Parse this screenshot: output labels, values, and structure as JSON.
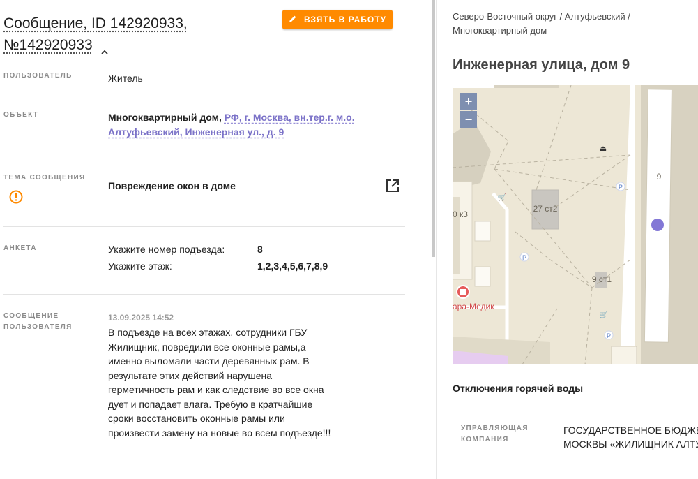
{
  "header": {
    "title_line1": "Сообщение, ID 142920933,",
    "title_line2": "№142920933",
    "take_button": "ВЗЯТЬ В РАБОТУ"
  },
  "fields": {
    "user": {
      "label": "ПОЛЬЗОВАТЕЛЬ",
      "value": "Житель"
    },
    "object": {
      "label": "ОБЪЕКТ",
      "type": "Многоквартирный дом,",
      "address_line1": "РФ, г. Москва, вн.тер.г. м.о.",
      "address_line2": "Алтуфьевский, Инженерная ул., д. 9"
    },
    "topic": {
      "label": "ТЕМА СООБЩЕНИЯ",
      "value": "Повреждение окон в доме"
    },
    "survey": {
      "label": "АНКЕТА",
      "questions": [
        {
          "q": "Укажите номер подъезда:",
          "a": "8"
        },
        {
          "q": "Укажите этаж:",
          "a": "1,2,3,4,5,6,7,8,9"
        }
      ]
    },
    "message": {
      "label_line1": "СООБЩЕНИЕ",
      "label_line2": "ПОЛЬЗОВАТЕЛЯ",
      "date": "13.09.2025 14:52",
      "text": "В подъезде на всех этажах, сотрудники ГБУ Жилищник, повредили все оконные рамы,а именно выломали части деревянных рам. В результате этих действий нарушена герметичность рам и как следствие во все окна дует и попадает влага. Требую в кратчайшие сроки восстановить оконные рамы или произвести замену на новые во всем подъезде!!!"
    }
  },
  "side": {
    "breadcrumb_line1": "Северо-Восточный округ / Алтуфьевский /",
    "breadcrumb_line2": "Многоквартирный дом",
    "address": "Инженерная улица, дом 9",
    "map": {
      "zoom_in": "+",
      "zoom_out": "−",
      "labels": {
        "house_9": "9",
        "bld_27": "27 ст2",
        "bld_9s1": "9 ст1",
        "bld_0k3": "0 к3",
        "medik": "ара-Медик",
        "parking": "P"
      }
    },
    "hot_water_title": "Отключения горячей воды",
    "company_label_line1": "УПРАВЛЯЮЩАЯ",
    "company_label_line2": "КОМПАНИЯ",
    "company_line1": "ГОСУДАРСТВЕННОЕ БЮДЖЕТ",
    "company_line2": "МОСКВЫ «ЖИЛИЩНИК АЛТУФ"
  },
  "colors": {
    "accent": "#ff8a00",
    "link": "#7b72c8",
    "marker": "#8378d6"
  },
  "icons": [
    "chevron-up-icon",
    "pencil-icon",
    "warning-icon",
    "external-link-icon"
  ]
}
